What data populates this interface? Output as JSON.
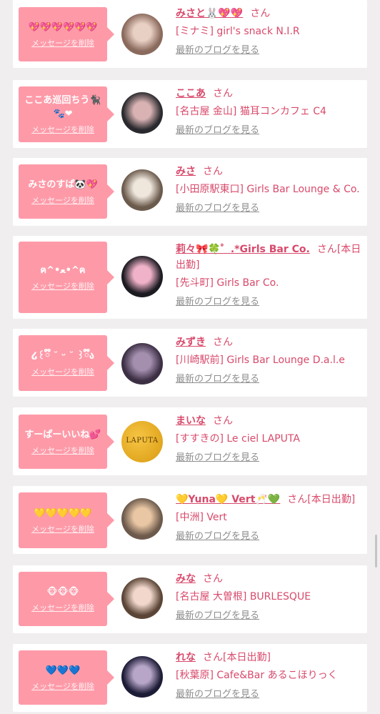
{
  "delete_label": "メッセージを削除",
  "blog_label": "最新のブログを見る",
  "honorific": "さん",
  "cards": [
    {
      "message": "💖💖💖💖💖💖",
      "name": "みさと🐰💖💖",
      "status": "",
      "shop": "[ミナミ] girl's snack N.I.R",
      "avatar_icon": "avatar-photo",
      "avatar_colors": [
        "#8a6a5c",
        "#e9d0c4"
      ]
    },
    {
      "message": "ここあ巡回ちう🐈‍⬛🐾❤",
      "name": "ここあ",
      "status": "",
      "shop": "[名古屋 金山] 猫耳コンカフェ C4",
      "avatar_icon": "avatar-photo",
      "avatar_colors": [
        "#2a2a2e",
        "#d9b3b4"
      ]
    },
    {
      "message": "みさのすぱ🐼💖",
      "name": "みさ",
      "status": "",
      "shop": "[小田原駅東口] Girls Bar Lounge & Co.",
      "avatar_icon": "avatar-photo",
      "avatar_colors": [
        "#6b5b4d",
        "#efe6dc"
      ]
    },
    {
      "message": "ฅ^•ﻌ•^ฅ",
      "name": "莉々🎀🍀゜.*Girls Bar Co.",
      "status": "[本日出勤]",
      "shop": "[先斗町] Girls Bar Co.",
      "avatar_icon": "avatar-photo",
      "avatar_colors": [
        "#1c1b22",
        "#f0b2c8"
      ]
    },
    {
      "message": "໒꒰ྀི ˘ ᵕ ˘ ꒱ྀིა",
      "name": "みずき",
      "status": "",
      "shop": "[川崎駅前] Girls Bar Lounge D.a.l.e",
      "avatar_icon": "avatar-photo",
      "avatar_colors": [
        "#3c2f44",
        "#a48faf"
      ]
    },
    {
      "message": "すーぱーいいね💕",
      "name": "まいな",
      "status": "",
      "shop": "[すすきの] Le ciel LAPUTA",
      "avatar_icon": "laputa-logo",
      "avatar_text": "LAPUTA",
      "avatar_colors": [
        "#d99a10",
        "#f6c544"
      ]
    },
    {
      "message": "💛💛💛💛💛",
      "name": "💛Yuna💛 Vert🥂💚",
      "status": "[本日出勤]",
      "shop": "[中洲] Vert",
      "avatar_icon": "avatar-photo",
      "avatar_colors": [
        "#6d5a4c",
        "#e9c7a4"
      ]
    },
    {
      "message": "🐵🐵🐵",
      "name": "みな",
      "status": "",
      "shop": "[名古屋 大曽根] BURLESQUE",
      "avatar_icon": "avatar-photo",
      "avatar_colors": [
        "#5b4536",
        "#f1d7cc"
      ]
    },
    {
      "message": "💙💙💙",
      "name": "れな",
      "status": "[本日出勤]",
      "shop": "[秋葉原] Cafe&Bar あるこほりっく",
      "avatar_icon": "avatar-photo",
      "avatar_colors": [
        "#1d1c36",
        "#b8a6c9"
      ]
    }
  ]
}
